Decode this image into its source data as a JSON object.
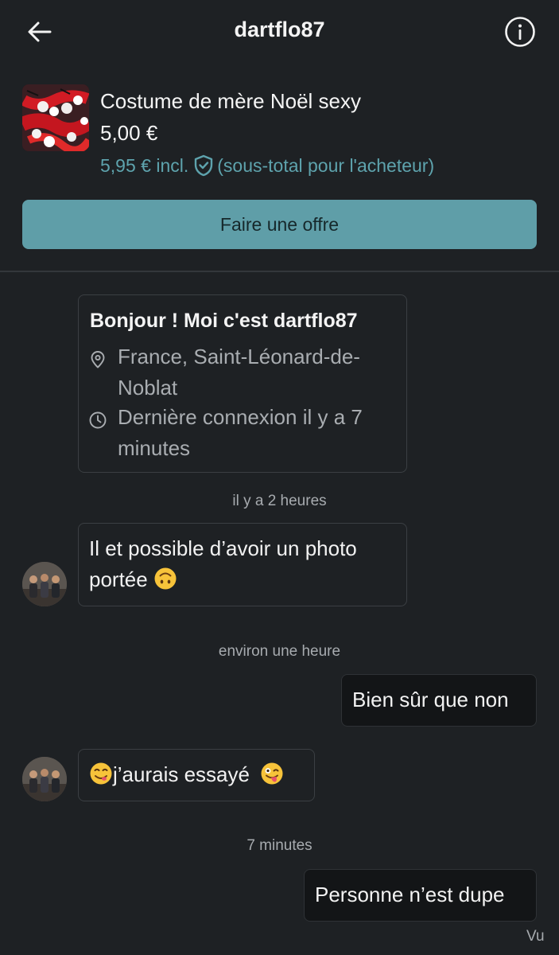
{
  "header": {
    "title": "dartflo87",
    "back_icon": "arrow-left-icon",
    "info_icon": "info-circle-icon"
  },
  "product": {
    "title": "Costume de mère Noël sexy",
    "price": "5,00 €",
    "price_incl": "5,95 € incl.",
    "protection_icon": "shield-check-icon",
    "subtotal_note": "(sous-total pour l'acheteur)"
  },
  "offer_button": {
    "label": "Faire une offre"
  },
  "profile_card": {
    "greeting": "Bonjour ! Moi c'est dartflo87",
    "location_icon": "location-pin-icon",
    "location": "France, Saint-Léonard-de-Noblat",
    "clock_icon": "clock-icon",
    "last_seen": "Dernière connexion il y a 7 minutes"
  },
  "messages": [
    {
      "timestamp": "il y a 2 heures",
      "direction": "incoming",
      "text": "Il et possible d’avoir un photo portée",
      "emoji_after": "upside-down-face-emoji"
    },
    {
      "timestamp": "environ une heure",
      "direction": "outgoing",
      "text": "Bien sûr que non"
    },
    {
      "timestamp": "",
      "direction": "incoming",
      "emoji_before": "yum-face-emoji",
      "text": "j’aurais essayé",
      "emoji_after": "winking-tongue-face-emoji"
    },
    {
      "timestamp": "7 minutes",
      "direction": "outgoing",
      "text": "Personne n’est dupe"
    }
  ],
  "read_status": "Vu",
  "colors": {
    "background": "#1e2124",
    "accent": "#5f9ea8",
    "accent_text": "#5ea3ad",
    "muted_text": "#a9adb1"
  }
}
